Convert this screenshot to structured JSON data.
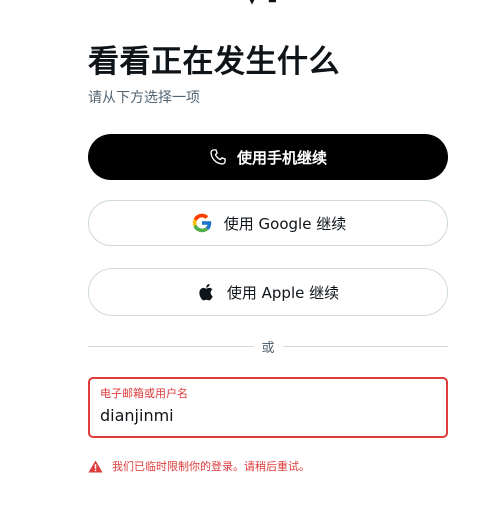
{
  "header": {
    "title": "看看正在发生什么",
    "subtitle": "请从下方选择一项"
  },
  "buttons": {
    "phone": {
      "label": "使用手机继续",
      "icon": "phone-icon"
    },
    "google": {
      "label": "使用 Google 继续",
      "icon": "google-logo-icon"
    },
    "apple": {
      "label": "使用 Apple 继续",
      "icon": "apple-logo-icon"
    }
  },
  "divider": {
    "text": "或"
  },
  "login_field": {
    "label": "电子邮箱或用户名",
    "value": "dianjinmi"
  },
  "error": {
    "message": "我们已临时限制你的登录。请稍后重试。",
    "icon": "warning-icon"
  },
  "colors": {
    "primary_button": "#000000",
    "border": "#cfd9de",
    "error": "#de3b3b",
    "muted_text": "#536471"
  }
}
